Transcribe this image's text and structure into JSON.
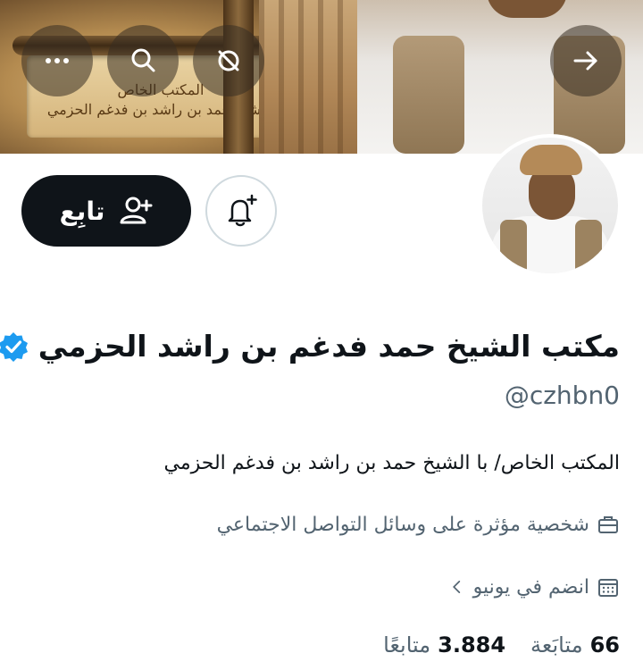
{
  "banner": {
    "scroll_line1": "المكتب الخاص",
    "scroll_line2": "بالشيخ حمد بن راشد بن فدغم الحزمي"
  },
  "nav": {
    "back_icon": "arrow-right-icon",
    "more_icon": "more-dots-icon",
    "search_icon": "search-icon",
    "refresh_icon": "refresh-icon"
  },
  "actions": {
    "follow_label": "تابِع",
    "follow_icon": "add-user-icon",
    "notify_icon": "bell-plus-icon"
  },
  "profile": {
    "name": "مكتب الشيخ حمد فدغم بن راشد الحزمي",
    "handle": "@czhbn0",
    "bio": "المكتب الخاص/ با الشيخ حمد بن راشد بن فدغم الحزمي",
    "category": "شخصية مؤثرة على وسائل التواصل الاجتماعي",
    "joined": "انضم في يونيو",
    "verified_color": "#1d9bf0"
  },
  "stats": {
    "following_count": "66",
    "following_label": "متابَعة",
    "followers_count": "3.884",
    "followers_label": "متابعًا"
  }
}
